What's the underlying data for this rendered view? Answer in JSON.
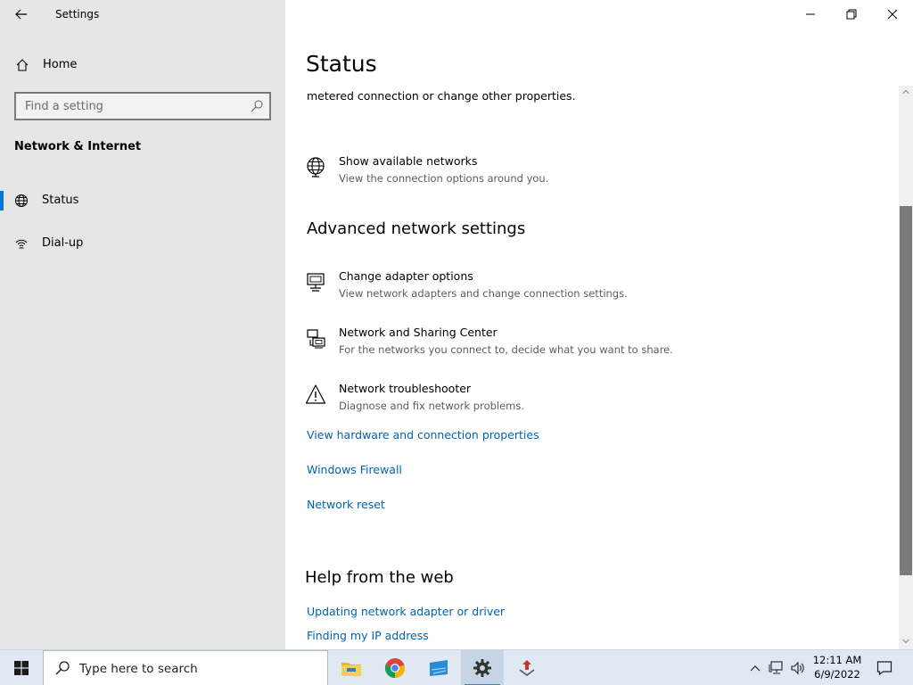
{
  "window": {
    "app_title": "Settings"
  },
  "sidebar": {
    "home_label": "Home",
    "search_placeholder": "Find a setting",
    "section_title": "Network & Internet",
    "items": [
      {
        "label": "Status",
        "icon": "globe-icon",
        "active": true
      },
      {
        "label": "Dial-up",
        "icon": "dialup-icon",
        "active": false
      }
    ]
  },
  "main": {
    "page_title": "Status",
    "clipped_line": "metered connection or change other properties.",
    "show_networks": {
      "title": "Show available networks",
      "subtitle": "View the connection options around you."
    },
    "advanced_heading": "Advanced network settings",
    "advanced_items": [
      {
        "title": "Change adapter options",
        "subtitle": "View network adapters and change connection settings.",
        "icon": "adapter-icon"
      },
      {
        "title": "Network and Sharing Center",
        "subtitle": "For the networks you connect to, decide what you want to share.",
        "icon": "sharing-center-icon"
      },
      {
        "title": "Network troubleshooter",
        "subtitle": "Diagnose and fix network problems.",
        "icon": "warning-icon"
      }
    ],
    "links": [
      "View hardware and connection properties",
      "Windows Firewall",
      "Network reset"
    ],
    "help_heading": "Help from the web",
    "help_links": [
      "Updating network adapter or driver",
      "Finding my IP address"
    ]
  },
  "taskbar": {
    "search_placeholder": "Type here to search",
    "apps": [
      {
        "name": "File Explorer",
        "icon": "file-explorer-icon"
      },
      {
        "name": "Google Chrome",
        "icon": "chrome-icon"
      },
      {
        "name": "Store",
        "icon": "store-icon"
      },
      {
        "name": "Settings",
        "icon": "gear-icon"
      },
      {
        "name": "App",
        "icon": "app-icon"
      }
    ],
    "time": "12:11 AM",
    "date": "6/9/2022"
  },
  "colors": {
    "accent": "#0078d7",
    "link": "#0063b1",
    "sidebar_bg": "#e6e6e6",
    "taskbar_bg": "#dfe8f3"
  }
}
